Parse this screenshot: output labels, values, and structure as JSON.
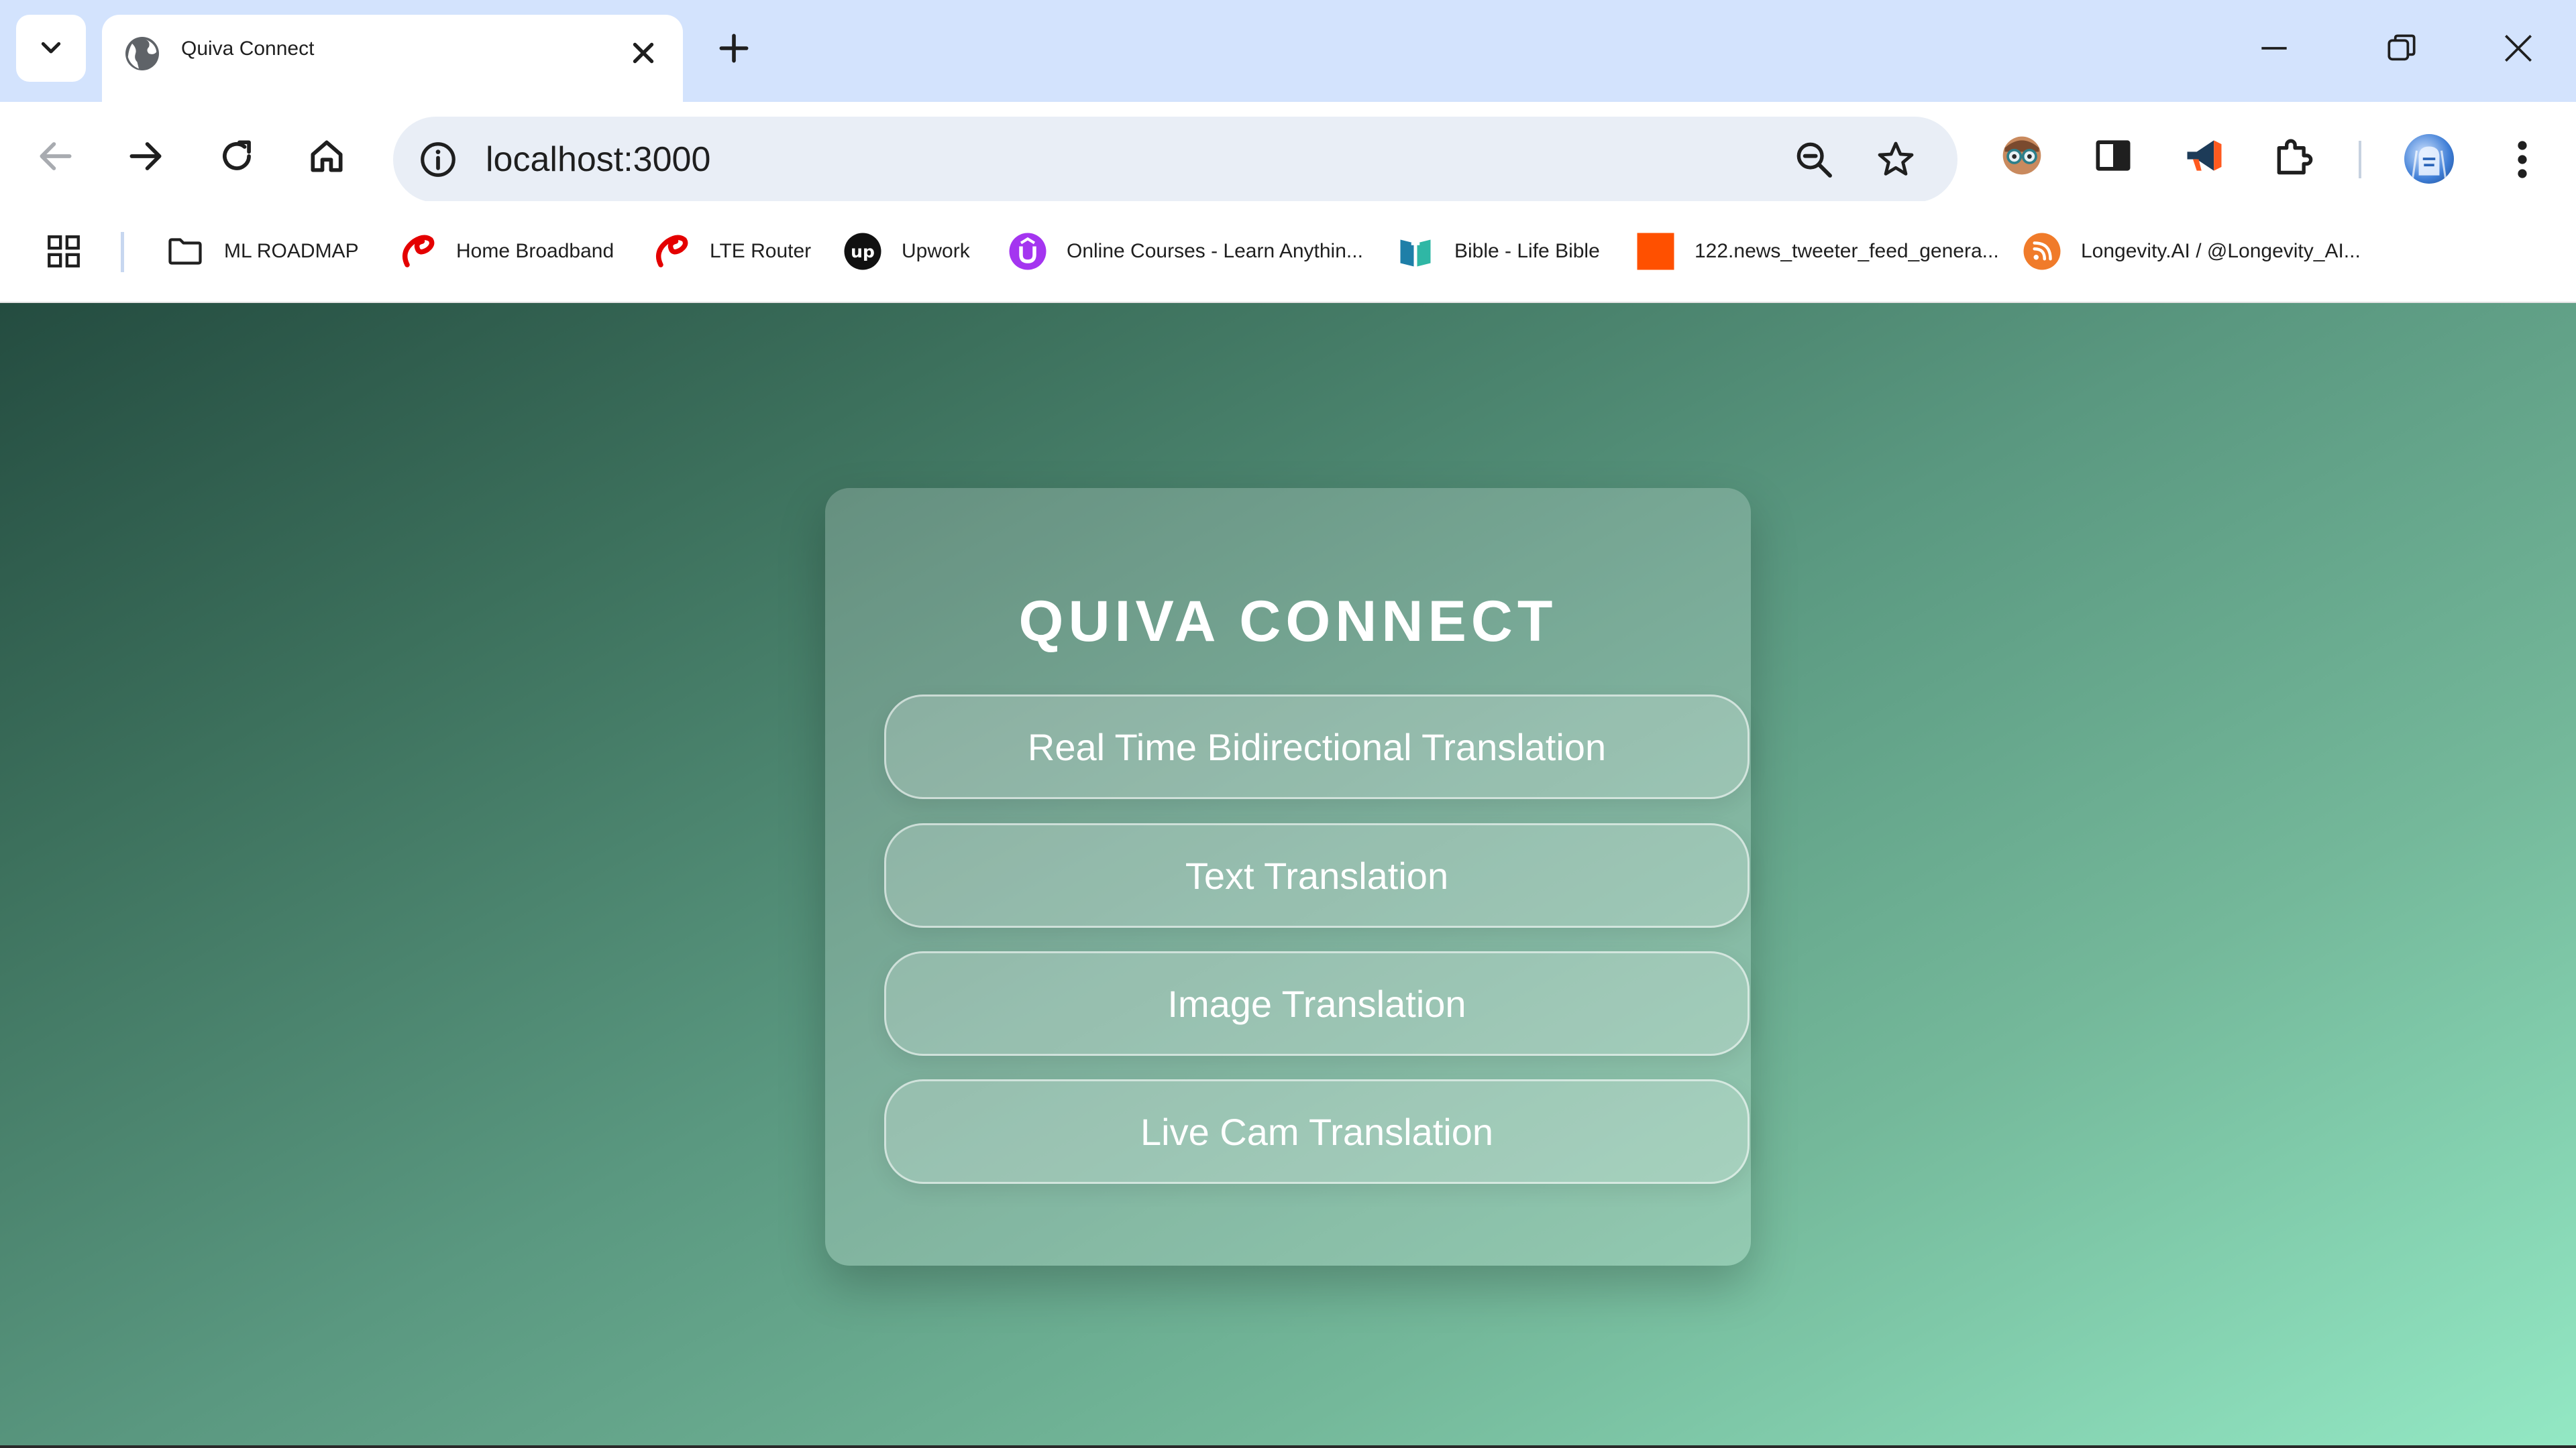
{
  "browser": {
    "tab": {
      "title": "Quiva Connect"
    },
    "address_bar": {
      "url": "localhost:3000"
    },
    "bookmarks": [
      {
        "label": "ML ROADMAP",
        "icon": "folder-icon"
      },
      {
        "label": "Home Broadband",
        "icon": "airtel-icon"
      },
      {
        "label": "LTE Router",
        "icon": "airtel-icon"
      },
      {
        "label": "Upwork",
        "icon": "upwork-icon"
      },
      {
        "label": "Online Courses - Learn Anythin...",
        "icon": "udemy-icon"
      },
      {
        "label": "Bible - Life Bible",
        "icon": "bible-icon"
      },
      {
        "label": "122.news_tweeter_feed_genera...",
        "icon": "orange-square-icon"
      },
      {
        "label": "Longevity.AI / @Longevity_AI...",
        "icon": "rss-icon"
      }
    ]
  },
  "page": {
    "title": "QUIVA CONNECT",
    "buttons": [
      {
        "label": "Real Time Bidirectional Translation"
      },
      {
        "label": "Text Translation"
      },
      {
        "label": "Image Translation"
      },
      {
        "label": "Live Cam Translation"
      }
    ]
  },
  "colors": {
    "tabstrip": "#d3e3fd",
    "omnibox": "#e9eef6",
    "gradient_start": "#244c40",
    "gradient_end": "#93e8c4"
  }
}
